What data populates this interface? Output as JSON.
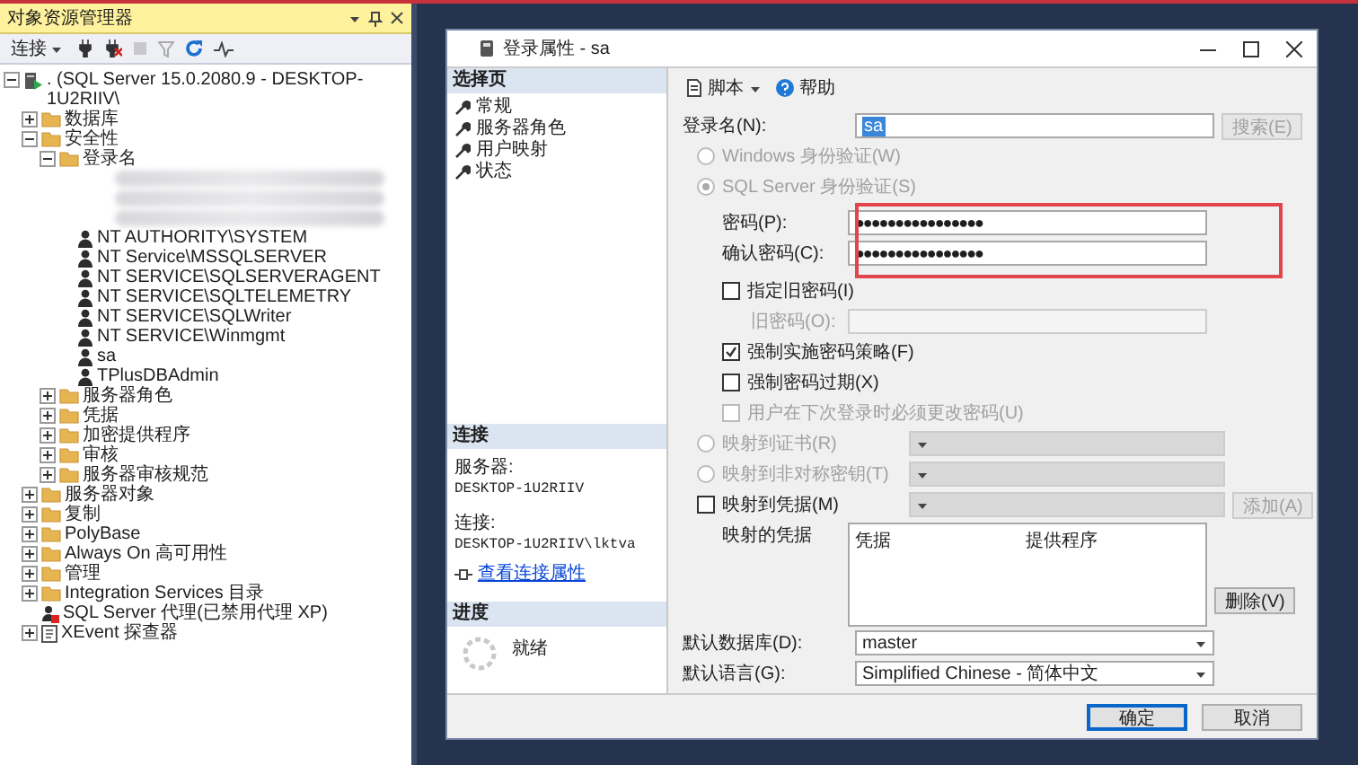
{
  "explorer": {
    "title": "对象资源管理器",
    "connect": "连接",
    "tree": [
      {
        "label": ". (SQL Server 15.0.2080.9 - DESKTOP-1U2RIIV\\",
        "kind": "server",
        "expanded": true,
        "children": [
          {
            "label": "数据库",
            "kind": "folder",
            "expanded": false
          },
          {
            "label": "安全性",
            "kind": "folder",
            "expanded": true,
            "children": [
              {
                "label": "登录名",
                "kind": "folder",
                "expanded": true,
                "children": [
                  {
                    "kind": "redacted"
                  },
                  {
                    "kind": "redacted"
                  },
                  {
                    "kind": "redacted"
                  },
                  {
                    "label": "NT AUTHORITY\\SYSTEM",
                    "kind": "user"
                  },
                  {
                    "label": "NT Service\\MSSQLSERVER",
                    "kind": "user"
                  },
                  {
                    "label": "NT SERVICE\\SQLSERVERAGENT",
                    "kind": "user"
                  },
                  {
                    "label": "NT SERVICE\\SQLTELEMETRY",
                    "kind": "user"
                  },
                  {
                    "label": "NT SERVICE\\SQLWriter",
                    "kind": "user"
                  },
                  {
                    "label": "NT SERVICE\\Winmgmt",
                    "kind": "user"
                  },
                  {
                    "label": "sa",
                    "kind": "user"
                  },
                  {
                    "label": "TPlusDBAdmin",
                    "kind": "user"
                  }
                ]
              },
              {
                "label": "服务器角色",
                "kind": "folder",
                "expanded": false
              },
              {
                "label": "凭据",
                "kind": "folder",
                "expanded": false
              },
              {
                "label": "加密提供程序",
                "kind": "folder",
                "expanded": false
              },
              {
                "label": "审核",
                "kind": "folder",
                "expanded": false
              },
              {
                "label": "服务器审核规范",
                "kind": "folder",
                "expanded": false
              }
            ]
          },
          {
            "label": "服务器对象",
            "kind": "folder",
            "expanded": false
          },
          {
            "label": "复制",
            "kind": "folder",
            "expanded": false
          },
          {
            "label": "PolyBase",
            "kind": "folder",
            "expanded": false
          },
          {
            "label": "Always On 高可用性",
            "kind": "folder",
            "expanded": false
          },
          {
            "label": "管理",
            "kind": "folder",
            "expanded": false
          },
          {
            "label": "Integration Services 目录",
            "kind": "folder",
            "expanded": false
          },
          {
            "label": "SQL Server 代理(已禁用代理 XP)",
            "kind": "agent"
          },
          {
            "label": "XEvent 探查器",
            "kind": "xevent",
            "expanded": false
          }
        ]
      }
    ]
  },
  "dialog": {
    "title": "登录属性 - sa",
    "select_page": {
      "heading": "选择页",
      "pages": [
        "常规",
        "服务器角色",
        "用户映射",
        "状态"
      ]
    },
    "connection": {
      "heading": "连接",
      "server_label": "服务器:",
      "server": "DESKTOP-1U2RIIV",
      "connection_label": "连接:",
      "connection": "DESKTOP-1U2RIIV\\lktva",
      "link": "查看连接属性"
    },
    "progress": {
      "heading": "进度",
      "status": "就绪"
    },
    "toolbar": {
      "script": "脚本",
      "help": "帮助"
    },
    "login_name": {
      "label": "登录名(N):",
      "value": "sa",
      "button": "搜索(E)"
    },
    "auth": [
      {
        "label": "Windows 身份验证(W)",
        "selected": false,
        "disabled": true
      },
      {
        "label": "SQL Server 身份验证(S)",
        "selected": true,
        "disabled": true
      }
    ],
    "password": {
      "label": "密码(P):",
      "value": "●●●●●●●●●●●●●●●●"
    },
    "confirm_password": {
      "label": "确认密码(C):",
      "value": "●●●●●●●●●●●●●●●●"
    },
    "old_password": {
      "checkbox": "指定旧密码(I)",
      "checked": false,
      "label": "旧密码(O):"
    },
    "policies": [
      {
        "label": "强制实施密码策略(F)",
        "checked": true,
        "disabled": false
      },
      {
        "label": "强制密码过期(X)",
        "checked": false,
        "disabled": false
      },
      {
        "label": "用户在下次登录时必须更改密码(U)",
        "checked": false,
        "disabled": true
      }
    ],
    "mappings": [
      {
        "label": "映射到证书(R)",
        "selected": false,
        "disabled": true
      },
      {
        "label": "映射到非对称密钥(T)",
        "selected": false,
        "disabled": true
      }
    ],
    "credential": {
      "label": "映射到凭据(M)",
      "checked": false,
      "button": "添加(A)"
    },
    "mapped_credentials": {
      "label": "映射的凭据",
      "columns": [
        "凭据",
        "提供程序"
      ],
      "button": "删除(V)"
    },
    "default_database": {
      "label": "默认数据库(D):",
      "value": "master"
    },
    "default_language": {
      "label": "默认语言(G):",
      "value": "Simplified Chinese - 简体中文"
    },
    "buttons": [
      {
        "label": "确定",
        "default": true
      },
      {
        "label": "取消",
        "default": false
      }
    ]
  }
}
